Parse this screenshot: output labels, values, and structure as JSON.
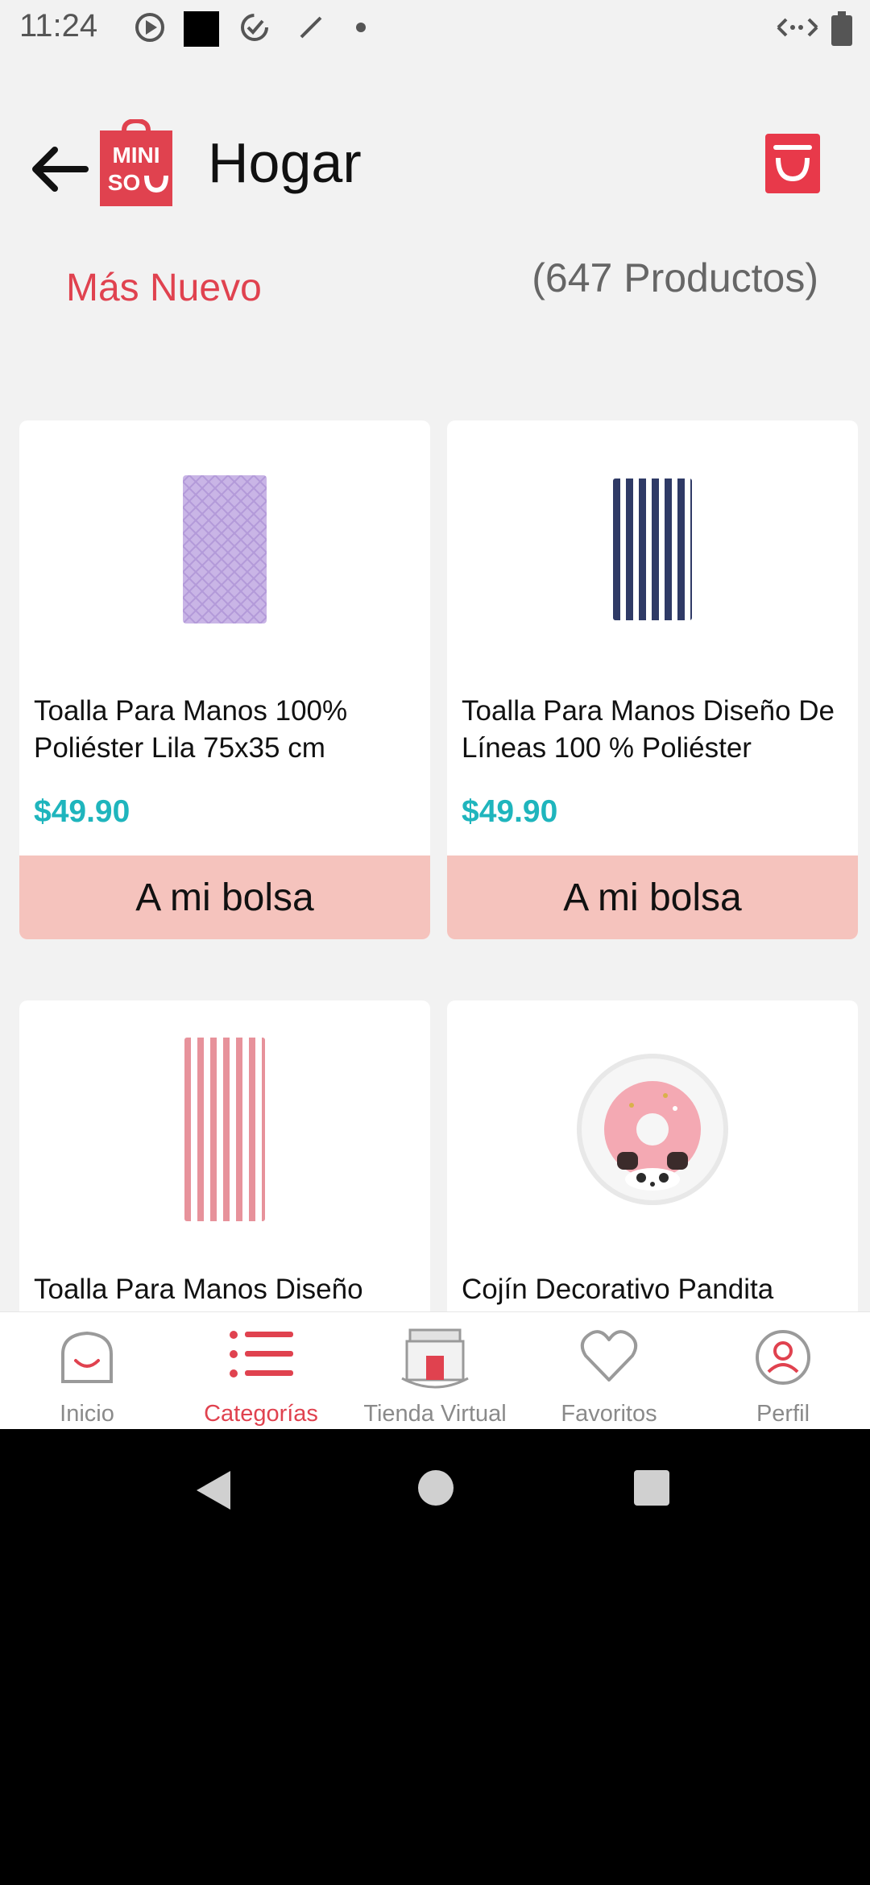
{
  "status_bar": {
    "time": "11:24"
  },
  "header": {
    "title": "Hogar",
    "logo_text_top": "MINI",
    "logo_text_bottom": "SO"
  },
  "filter": {
    "sort_label": "Más Nuevo",
    "count_label": "(647 Productos)"
  },
  "products": [
    {
      "title": "Toalla Para Manos 100% Poliéster Lila 75x35 cm",
      "price": "$49.90",
      "button": "A mi bolsa"
    },
    {
      "title": "Toalla Para Manos Diseño De Líneas 100 % Poliéster",
      "price": "$49.90",
      "button": "A mi bolsa"
    },
    {
      "title": "Toalla Para Manos Diseño",
      "price": "",
      "button": ""
    },
    {
      "title": "Cojín Decorativo Pandita",
      "price": "",
      "button": ""
    }
  ],
  "bottom_nav": [
    {
      "label": "Inicio",
      "icon": "home-icon"
    },
    {
      "label": "Categorías",
      "icon": "list-icon",
      "active": true
    },
    {
      "label": "Tienda Virtual",
      "icon": "store-icon"
    },
    {
      "label": "Favoritos",
      "icon": "heart-icon"
    },
    {
      "label": "Perfil",
      "icon": "profile-icon"
    }
  ],
  "colors": {
    "brand": "#e0424f",
    "price": "#1fb5bd",
    "button_bg": "#f5c3bd"
  }
}
